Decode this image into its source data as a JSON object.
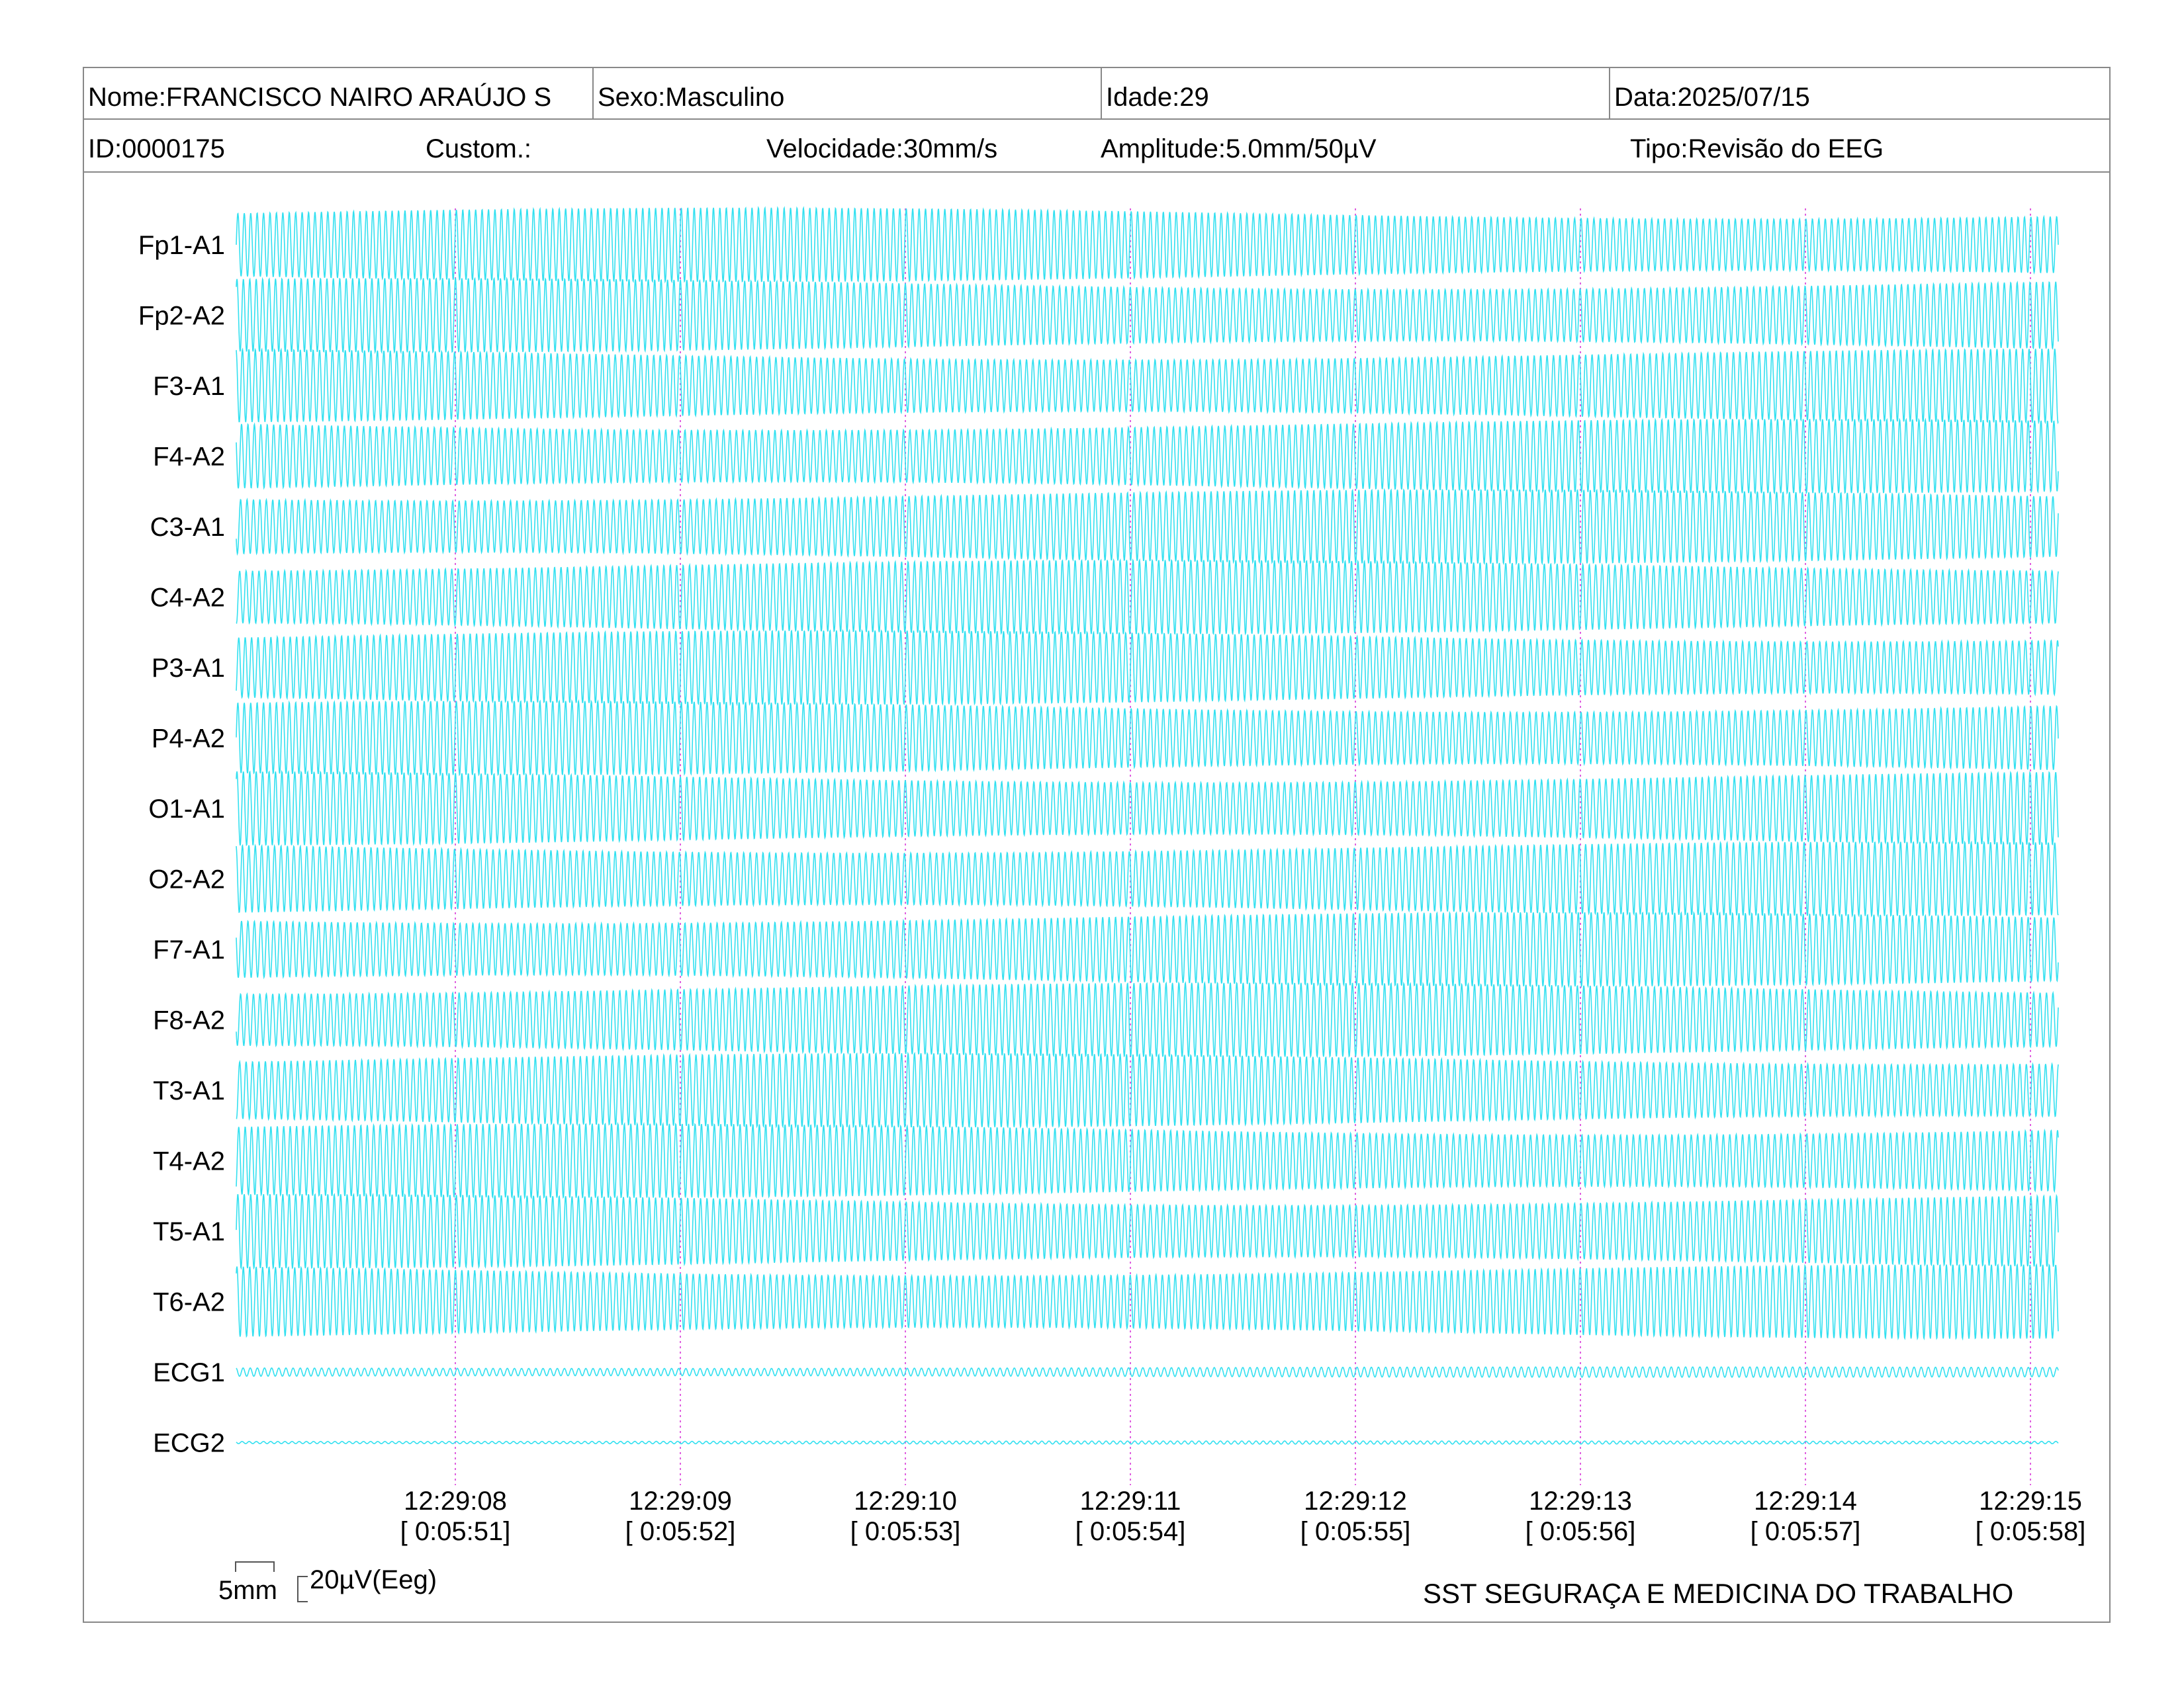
{
  "header": {
    "nome": "Nome:FRANCISCO NAIRO ARAÚJO S",
    "sexo": "Sexo:Masculino",
    "idade": "Idade:29",
    "data": "Data:2025/07/15",
    "id": "ID:0000175",
    "custom": "Custom.:",
    "velocidade": "Velocidade:30mm/s",
    "amplitude": "Amplitude:5.0mm/50µV",
    "tipo": "Tipo:Revisão do EEG"
  },
  "colors": {
    "trace": "#33e0f0",
    "time_marker": "#e060e0",
    "border": "#888888"
  },
  "chart_data": {
    "type": "line",
    "title": "",
    "xlabel": "",
    "ylabel": "",
    "channels": [
      "Fp1-A1",
      "Fp2-A2",
      "F3-A1",
      "F4-A2",
      "C3-A1",
      "C4-A2",
      "P3-A1",
      "P4-A2",
      "O1-A1",
      "O2-A2",
      "F7-A1",
      "F8-A2",
      "T3-A1",
      "T4-A2",
      "T5-A1",
      "T6-A2",
      "ECG1",
      "ECG2"
    ],
    "time_markers": [
      {
        "clock": "12:29:08",
        "elapsed": "[ 0:05:51]"
      },
      {
        "clock": "12:29:09",
        "elapsed": "[ 0:05:52]"
      },
      {
        "clock": "12:29:10",
        "elapsed": "[ 0:05:53]"
      },
      {
        "clock": "12:29:11",
        "elapsed": "[ 0:05:54]"
      },
      {
        "clock": "12:29:12",
        "elapsed": "[ 0:05:55]"
      },
      {
        "clock": "12:29:13",
        "elapsed": "[ 0:05:56]"
      },
      {
        "clock": "12:29:14",
        "elapsed": "[ 0:05:57]"
      },
      {
        "clock": "12:29:15",
        "elapsed": "[ 0:05:58]"
      }
    ],
    "x_range_seconds": [
      0,
      8.1
    ],
    "waveform": {
      "eeg_cycles_per_second": 35,
      "eeg_amplitude_relative": 1.0,
      "ecg1_amplitude_relative": 0.1,
      "ecg2_amplitude_relative": 0.03
    },
    "grid": false
  },
  "scale": {
    "time_label": "5mm",
    "amplitude_label": "20µV(Eeg)"
  },
  "footer": {
    "organization": "SST SEGURAÇA E MEDICINA DO TRABALHO"
  }
}
